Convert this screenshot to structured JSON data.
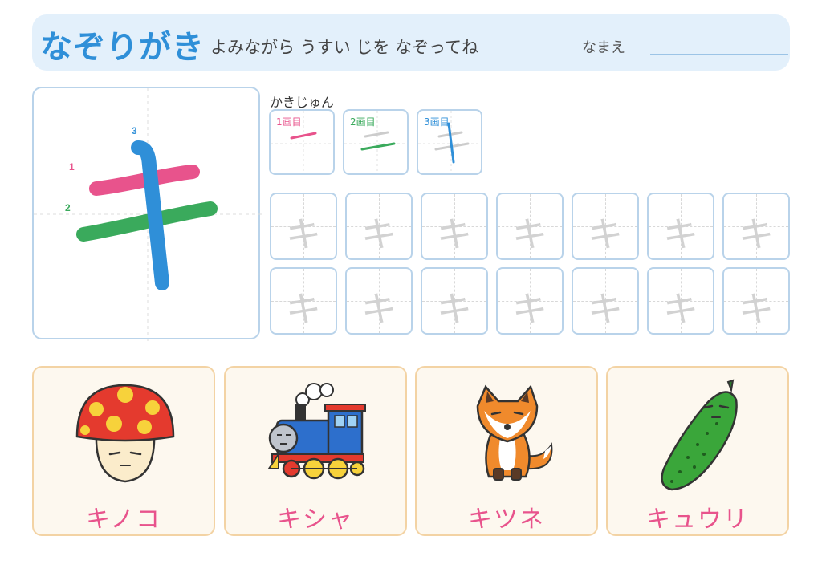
{
  "header": {
    "title": "なぞりがき",
    "subtitle": "よみながら うすい じを なぞってね",
    "name_label": "なまえ"
  },
  "main_char": {
    "char": "キ",
    "stroke_numbers": [
      "1",
      "2",
      "3"
    ]
  },
  "stroke_order": {
    "label": "かきじゅん",
    "steps": [
      "1画目",
      "2画目",
      "3画目"
    ]
  },
  "colors": {
    "stroke1": "#e8538c",
    "stroke2": "#3aaa5c",
    "stroke3": "#2f8fd8",
    "word": "#e8538c",
    "title": "#2f8fd8"
  },
  "practice": {
    "ghost_char": "キ"
  },
  "cards": [
    {
      "word": "キノコ",
      "icon": "mushroom-icon"
    },
    {
      "word": "キシャ",
      "icon": "train-icon"
    },
    {
      "word": "キツネ",
      "icon": "fox-icon"
    },
    {
      "word": "キュウリ",
      "icon": "cucumber-icon"
    }
  ]
}
